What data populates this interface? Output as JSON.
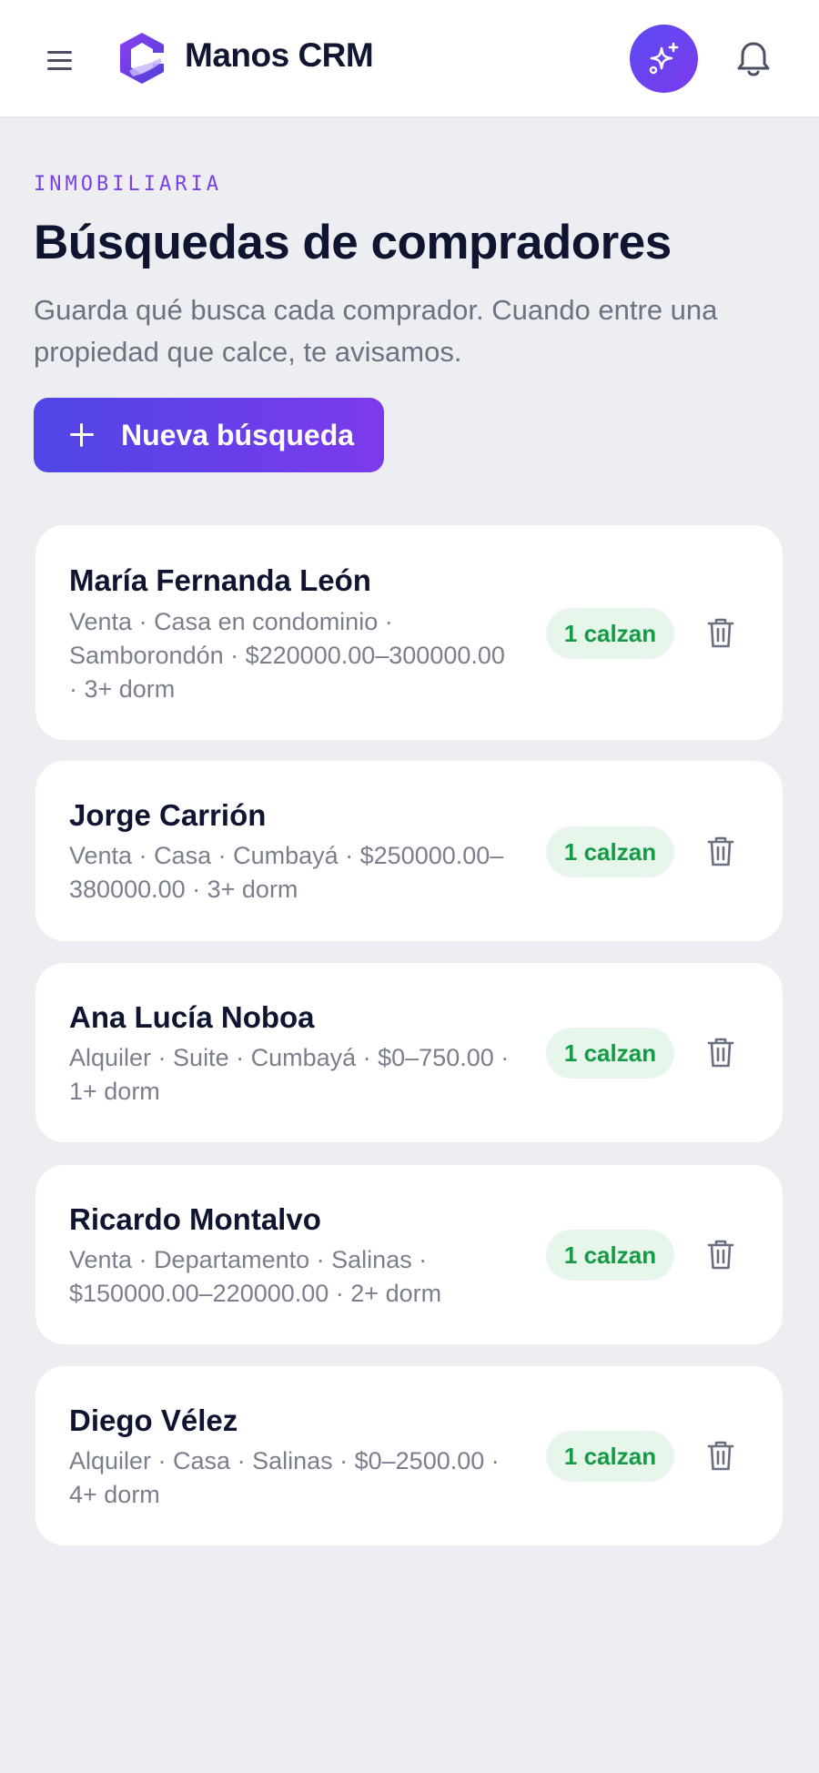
{
  "header": {
    "app_name": "Manos CRM",
    "menu_icon": "hamburger-menu-icon",
    "ai_icon": "sparkles-icon",
    "notifications_icon": "bell-icon",
    "accent_color": "#5b4bf2"
  },
  "page": {
    "eyebrow": "INMOBILIARIA",
    "title": "Búsquedas de compradores",
    "subtitle": "Guarda qué busca cada comprador. Cuando entre una propiedad que calce, te avisamos.",
    "new_button_label": "Nueva búsqueda"
  },
  "searches": [
    {
      "name": "María Fernanda León",
      "details": "Venta · Casa en condominio · Samborondón · $220000.00–300000.00 · 3+ dorm",
      "matches": "1 calzan"
    },
    {
      "name": "Jorge Carrión",
      "details": "Venta · Casa · Cumbayá · $250000.00–380000.00 · 3+ dorm",
      "matches": "1 calzan"
    },
    {
      "name": "Ana Lucía Noboa",
      "details": "Alquiler · Suite · Cumbayá · $0–750.00 · 1+ dorm",
      "matches": "1 calzan"
    },
    {
      "name": "Ricardo Montalvo",
      "details": "Venta · Departamento · Salinas · $150000.00–220000.00 · 2+ dorm",
      "matches": "1 calzan"
    },
    {
      "name": "Diego Vélez",
      "details": "Alquiler · Casa · Salinas · $0–2500.00 · 4+ dorm",
      "matches": "1 calzan"
    }
  ]
}
